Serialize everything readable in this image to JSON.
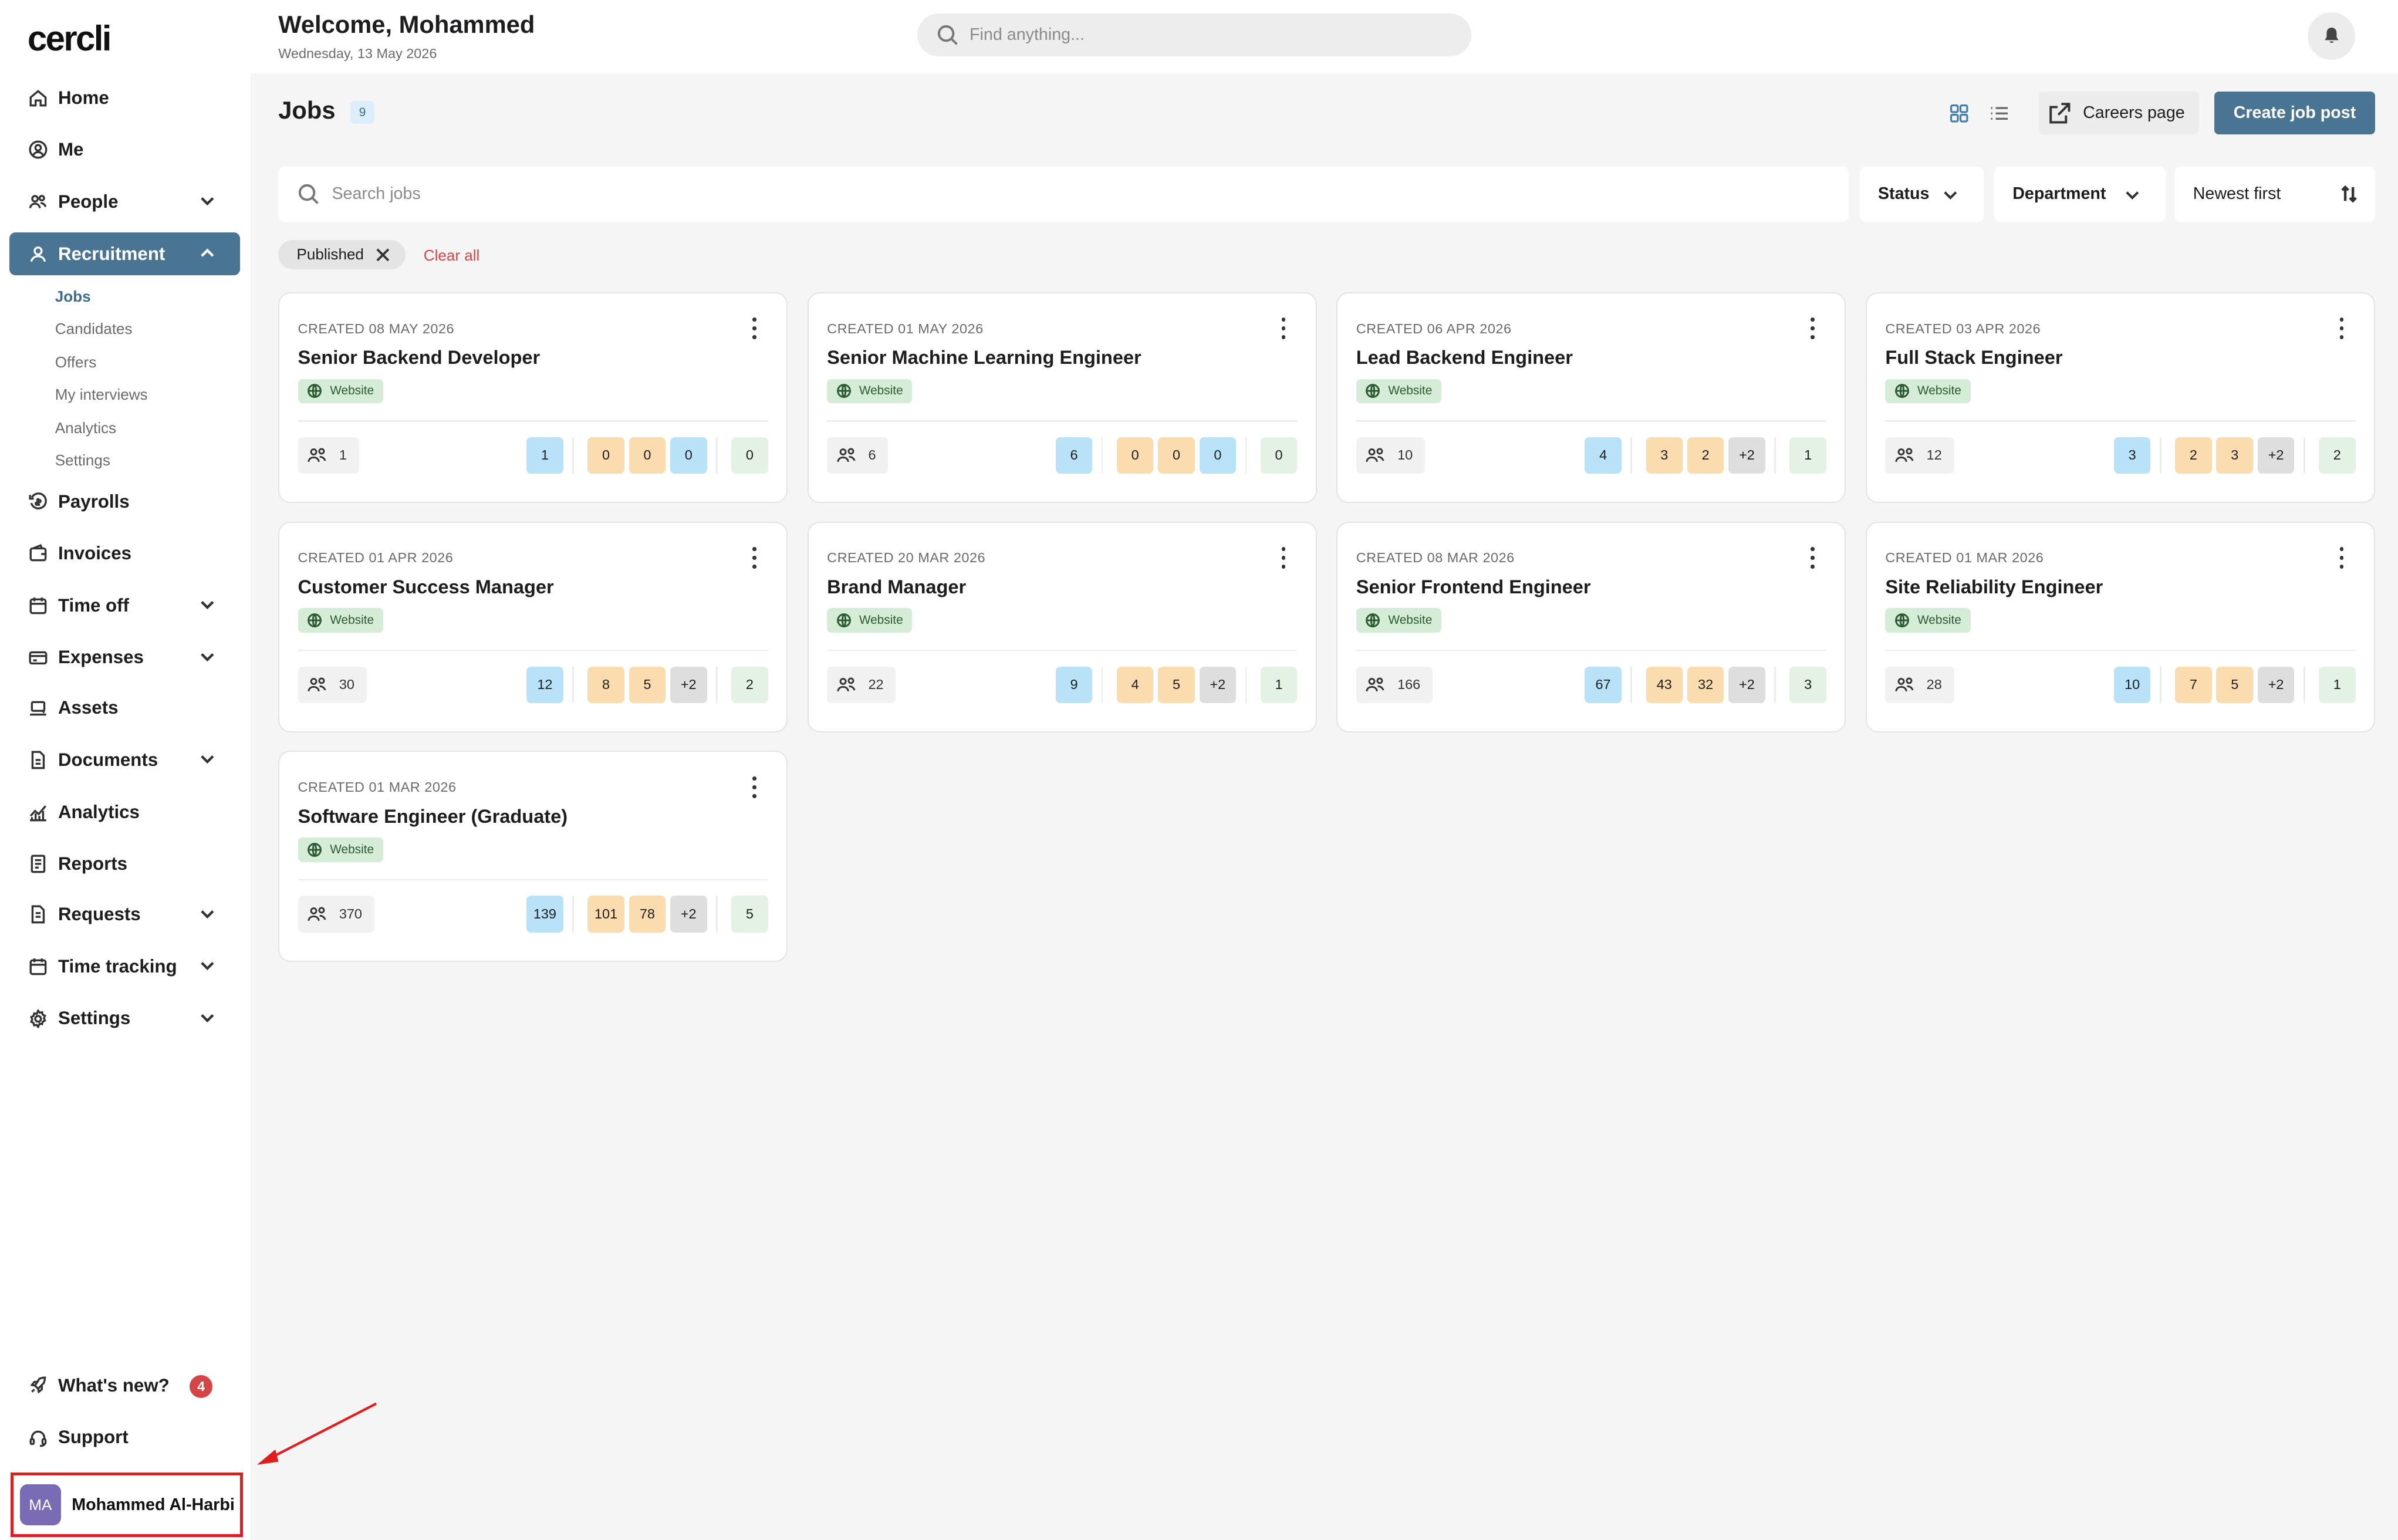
{
  "app": {
    "logo": "cercli"
  },
  "header": {
    "welcome": "Welcome, Mohammed",
    "date": "Wednesday, 13 May 2026",
    "search_placeholder": "Find anything..."
  },
  "sidebar": {
    "items": [
      {
        "label": "Home",
        "icon": "home-icon"
      },
      {
        "label": "Me",
        "icon": "user-circle-icon"
      },
      {
        "label": "People",
        "icon": "people-icon"
      },
      {
        "label": "Recruitment",
        "icon": "user-icon"
      },
      {
        "label": "Payrolls",
        "icon": "payroll-icon"
      },
      {
        "label": "Invoices",
        "icon": "wallet-icon"
      },
      {
        "label": "Time off",
        "icon": "calendar-icon"
      },
      {
        "label": "Expenses",
        "icon": "expenses-icon"
      },
      {
        "label": "Assets",
        "icon": "laptop-icon"
      },
      {
        "label": "Documents",
        "icon": "document-icon"
      },
      {
        "label": "Analytics",
        "icon": "analytics-icon"
      },
      {
        "label": "Reports",
        "icon": "report-icon"
      },
      {
        "label": "Requests",
        "icon": "request-icon"
      },
      {
        "label": "Time tracking",
        "icon": "calendar-clock-icon"
      },
      {
        "label": "Settings",
        "icon": "gear-icon"
      }
    ],
    "recruitment_sub": [
      "Jobs",
      "Candidates",
      "Offers",
      "My interviews",
      "Analytics",
      "Settings"
    ],
    "whats_new": "What's new?",
    "whats_new_count": "4",
    "support": "Support",
    "user": {
      "initials": "MA",
      "name": "Mohammed Al-Harbi"
    }
  },
  "main": {
    "title": "Jobs",
    "count": "9",
    "careers_page": "Careers page",
    "create_job": "Create job post",
    "search_placeholder": "Search jobs",
    "filters": {
      "status": "Status",
      "department": "Department",
      "sort": "Newest first"
    },
    "active_filter": "Published",
    "clear_all": "Clear all"
  },
  "jobs": [
    {
      "created": "CREATED 08 MAY 2026",
      "title": "Senior Backend Developer",
      "tag": "Website",
      "applicants": "1",
      "s1": "1",
      "s2": "0",
      "s3": "0",
      "s4": "0",
      "s4_color": "blue",
      "last": "0"
    },
    {
      "created": "CREATED 01 MAY 2026",
      "title": "Senior Machine Learning Engineer",
      "tag": "Website",
      "applicants": "6",
      "s1": "6",
      "s2": "0",
      "s3": "0",
      "s4": "0",
      "s4_color": "blue",
      "last": "0"
    },
    {
      "created": "CREATED 06 APR 2026",
      "title": "Lead Backend Engineer",
      "tag": "Website",
      "applicants": "10",
      "s1": "4",
      "s2": "3",
      "s3": "2",
      "s4": "+2",
      "s4_color": "gray",
      "last": "1"
    },
    {
      "created": "CREATED 03 APR 2026",
      "title": "Full Stack Engineer",
      "tag": "Website",
      "applicants": "12",
      "s1": "3",
      "s2": "2",
      "s3": "3",
      "s4": "+2",
      "s4_color": "gray",
      "last": "2"
    },
    {
      "created": "CREATED 01 APR 2026",
      "title": "Customer Success Manager",
      "tag": "Website",
      "applicants": "30",
      "s1": "12",
      "s2": "8",
      "s3": "5",
      "s4": "+2",
      "s4_color": "gray",
      "last": "2"
    },
    {
      "created": "CREATED 20 MAR 2026",
      "title": "Brand Manager",
      "tag": "Website",
      "applicants": "22",
      "s1": "9",
      "s2": "4",
      "s3": "5",
      "s4": "+2",
      "s4_color": "gray",
      "last": "1"
    },
    {
      "created": "CREATED 08 MAR 2026",
      "title": "Senior Frontend Engineer",
      "tag": "Website",
      "applicants": "166",
      "s1": "67",
      "s2": "43",
      "s3": "32",
      "s4": "+2",
      "s4_color": "gray",
      "last": "3"
    },
    {
      "created": "CREATED 01 MAR 2026",
      "title": "Site Reliability Engineer",
      "tag": "Website",
      "applicants": "28",
      "s1": "10",
      "s2": "7",
      "s3": "5",
      "s4": "+2",
      "s4_color": "gray",
      "last": "1"
    },
    {
      "created": "CREATED 01 MAR 2026",
      "title": "Software Engineer (Graduate)",
      "tag": "Website",
      "applicants": "370",
      "s1": "139",
      "s2": "101",
      "s3": "78",
      "s4": "+2",
      "s4_color": "gray",
      "last": "5"
    }
  ],
  "colors": {
    "accent": "#497592",
    "danger": "#d64545",
    "stage_blue": "#b8e2f8",
    "stage_orange": "#fbdcae",
    "stage_gray": "#dedede",
    "stage_green": "#e4f2e4",
    "tag_green": "#d5ecd7"
  }
}
